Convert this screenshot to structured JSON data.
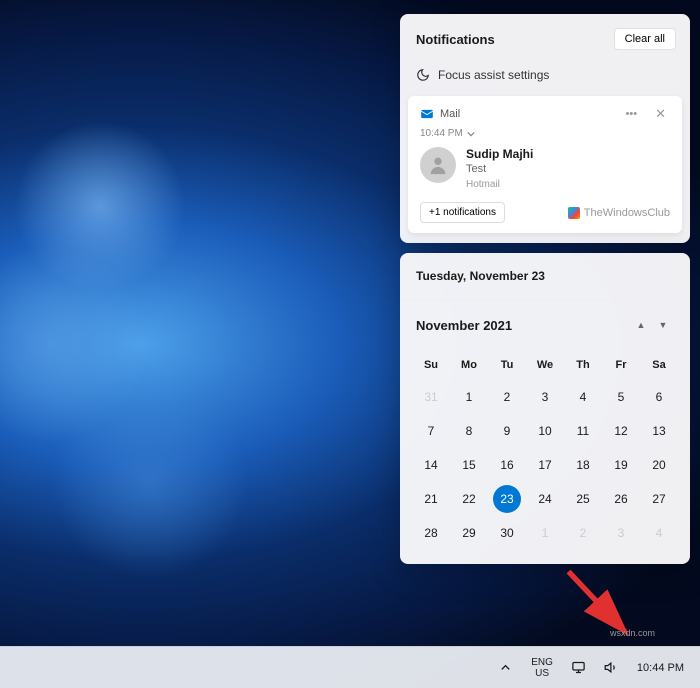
{
  "notifications": {
    "header_title": "Notifications",
    "clear_all_label": "Clear all",
    "focus_assist_label": "Focus assist settings"
  },
  "mail_card": {
    "app_name": "Mail",
    "timestamp": "10:44 PM",
    "sender": "Sudip Majhi",
    "subject": "Test",
    "account": "Hotmail",
    "more_notifications_label": "+1 notifications",
    "watermark": "TheWindowsClub"
  },
  "calendar": {
    "full_date": "Tuesday, November 23",
    "month_label": "November 2021",
    "dow": [
      "Su",
      "Mo",
      "Tu",
      "We",
      "Th",
      "Fr",
      "Sa"
    ],
    "weeks": [
      [
        {
          "n": "31",
          "out": true
        },
        {
          "n": "1"
        },
        {
          "n": "2"
        },
        {
          "n": "3"
        },
        {
          "n": "4"
        },
        {
          "n": "5"
        },
        {
          "n": "6"
        }
      ],
      [
        {
          "n": "7"
        },
        {
          "n": "8"
        },
        {
          "n": "9"
        },
        {
          "n": "10"
        },
        {
          "n": "11"
        },
        {
          "n": "12"
        },
        {
          "n": "13"
        }
      ],
      [
        {
          "n": "14"
        },
        {
          "n": "15"
        },
        {
          "n": "16"
        },
        {
          "n": "17"
        },
        {
          "n": "18"
        },
        {
          "n": "19"
        },
        {
          "n": "20"
        }
      ],
      [
        {
          "n": "21"
        },
        {
          "n": "22"
        },
        {
          "n": "23",
          "today": true
        },
        {
          "n": "24"
        },
        {
          "n": "25"
        },
        {
          "n": "26"
        },
        {
          "n": "27"
        }
      ],
      [
        {
          "n": "28"
        },
        {
          "n": "29"
        },
        {
          "n": "30"
        },
        {
          "n": "1",
          "out": true
        },
        {
          "n": "2",
          "out": true
        },
        {
          "n": "3",
          "out": true
        },
        {
          "n": "4",
          "out": true
        }
      ]
    ]
  },
  "taskbar": {
    "language_top": "ENG",
    "language_bottom": "US",
    "clock": "10:44 PM"
  },
  "watermark_corner": "wsxdn.com"
}
